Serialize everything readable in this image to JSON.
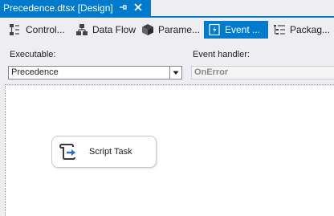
{
  "document_tab": {
    "title": "Precedence.dtsx [Design]",
    "pin_icon": "pin-icon",
    "close_icon": "close-icon"
  },
  "designer_tabs": [
    {
      "label": "Control...",
      "icon": "control-flow-icon",
      "active": false
    },
    {
      "label": "Data Flow",
      "icon": "data-flow-icon",
      "active": false
    },
    {
      "label": "Parame...",
      "icon": "parameters-icon",
      "active": false
    },
    {
      "label": "Event ...",
      "icon": "event-handlers-icon",
      "active": true
    },
    {
      "label": "Packag...",
      "icon": "package-explorer-icon",
      "active": false
    }
  ],
  "executable": {
    "label": "Executable:",
    "value": "Precedence"
  },
  "event_handler": {
    "label": "Event handler:",
    "value": "OnError"
  },
  "task": {
    "label": "Script Task",
    "icon": "script-task-icon"
  },
  "colors": {
    "accent": "#007acc",
    "chrome": "#eeeef2",
    "surface": "#ffffff"
  }
}
